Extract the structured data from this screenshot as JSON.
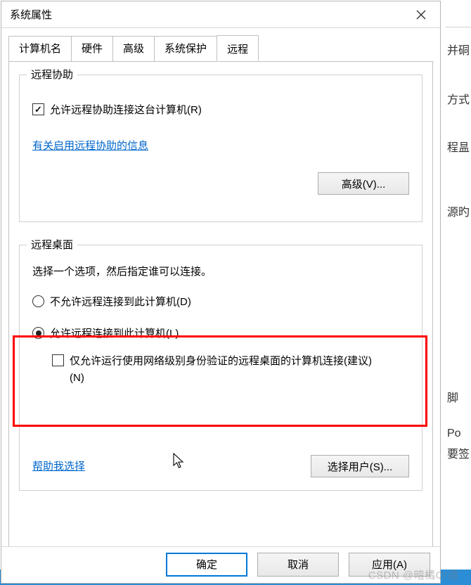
{
  "window": {
    "title": "系统属性"
  },
  "tabs": {
    "t0": "计算机名",
    "t1": "硬件",
    "t2": "高级",
    "t3": "系统保护",
    "t4": "远程"
  },
  "assist": {
    "legend": "远程协助",
    "allow_label": "允许远程协助连接这台计算机(R)",
    "allow_checked": true,
    "info_link": "有关启用远程协助的信息",
    "advanced_btn": "高级(V)..."
  },
  "desktop": {
    "legend": "远程桌面",
    "desc": "选择一个选项，然后指定谁可以连接。",
    "opt_deny": "不允许远程连接到此计算机(D)",
    "opt_allow": "允许远程连接到此计算机(L)",
    "selected": "allow",
    "nla_label": "仅允许运行使用网络级别身份验证的远程桌面的计算机连接(建议)(N)",
    "nla_checked": false,
    "help_link": "帮助我选择",
    "select_users_btn": "选择用户(S)..."
  },
  "buttons": {
    "ok": "确定",
    "cancel": "取消",
    "apply": "应用(A)"
  },
  "side": {
    "s1": "并硐",
    "s2": "方式",
    "s3": "程昷",
    "s4": "源旳",
    "s5": "脚",
    "s6": "Po",
    "s7": "要签"
  },
  "watermark": "CSDN @暗橘O!通"
}
